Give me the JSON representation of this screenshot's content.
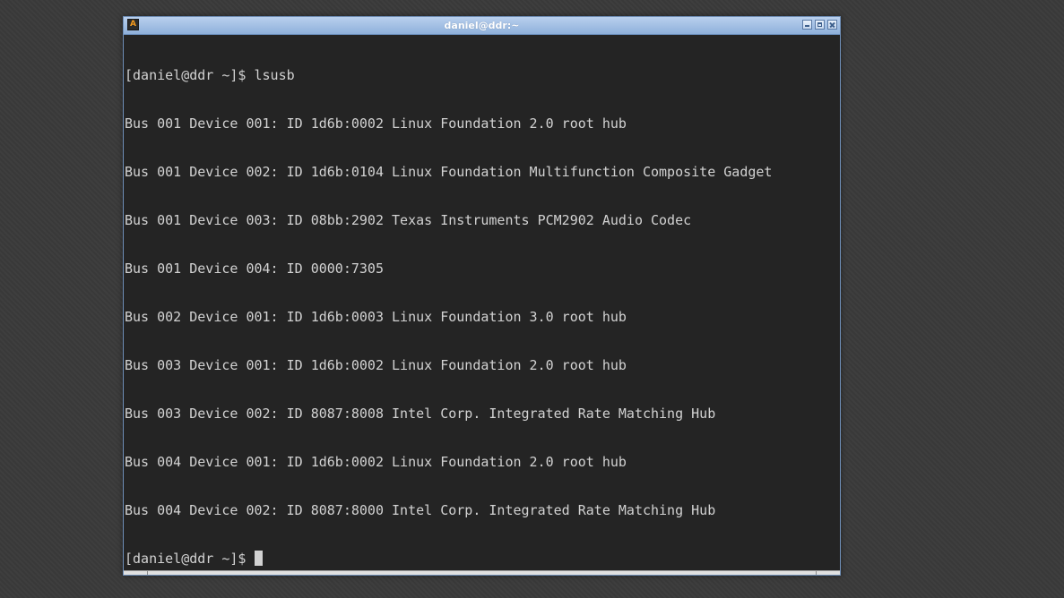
{
  "window": {
    "title": "daniel@ddr:~",
    "app_icon": "terminal-app-icon",
    "icon_glyph": "A",
    "controls": [
      "minimize",
      "maximize",
      "close"
    ]
  },
  "terminal": {
    "prompt": "[daniel@ddr ~]$ ",
    "command": "lsusb",
    "output": [
      "Bus 001 Device 001: ID 1d6b:0002 Linux Foundation 2.0 root hub",
      "Bus 001 Device 002: ID 1d6b:0104 Linux Foundation Multifunction Composite Gadget",
      "Bus 001 Device 003: ID 08bb:2902 Texas Instruments PCM2902 Audio Codec",
      "Bus 001 Device 004: ID 0000:7305",
      "Bus 002 Device 001: ID 1d6b:0003 Linux Foundation 3.0 root hub",
      "Bus 003 Device 001: ID 1d6b:0002 Linux Foundation 2.0 root hub",
      "Bus 003 Device 002: ID 8087:8008 Intel Corp. Integrated Rate Matching Hub",
      "Bus 004 Device 001: ID 1d6b:0002 Linux Foundation 2.0 root hub",
      "Bus 004 Device 002: ID 8087:8000 Intel Corp. Integrated Rate Matching Hub"
    ],
    "final_prompt": "[daniel@ddr ~]$ "
  },
  "colors": {
    "desktop": "#3a3a3a",
    "terminal_bg": "#242424",
    "terminal_fg": "#d2d2d2",
    "titlebar": "#a3c0e4",
    "title_text": "#ffffff"
  }
}
